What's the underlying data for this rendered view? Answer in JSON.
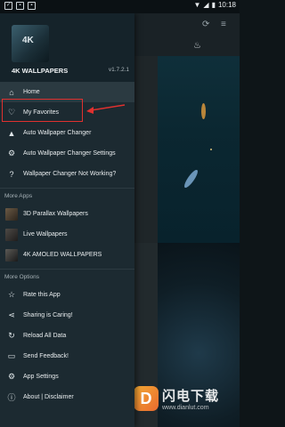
{
  "status_bar": {
    "time": "10:18"
  },
  "app": {
    "title": "4K WALLPAPERS",
    "version": "v1.7.2.1",
    "logo_text": "4K"
  },
  "menu": [
    {
      "label": "Home",
      "icon": "home-icon"
    },
    {
      "label": "My Favorites",
      "icon": "heart-icon"
    },
    {
      "label": "Auto Wallpaper Changer",
      "icon": "mountain-icon"
    },
    {
      "label": "Auto Wallpaper Changer Settings",
      "icon": "gear-icon"
    },
    {
      "label": "Wallpaper Changer Not Working?",
      "icon": "help-icon"
    }
  ],
  "more_apps": {
    "header": "More Apps",
    "items": [
      {
        "label": "3D Parallax Wallpapers"
      },
      {
        "label": "Live Wallpapers"
      },
      {
        "label": "4K AMOLED WALLPAPERS"
      }
    ]
  },
  "more_options": {
    "header": "More Options",
    "items": [
      {
        "label": "Rate this App",
        "icon": "star-icon"
      },
      {
        "label": "Sharing is Caring!",
        "icon": "share-icon"
      },
      {
        "label": "Reload All Data",
        "icon": "reload-icon"
      },
      {
        "label": "Send Feedback!",
        "icon": "feedback-icon"
      },
      {
        "label": "App Settings",
        "icon": "gear-icon"
      },
      {
        "label": "About | Disclaimer",
        "icon": "info-icon"
      }
    ]
  },
  "watermark": {
    "logo": "D",
    "title": "闪电下载",
    "url": "www.dianlut.com"
  },
  "colors": {
    "drawer": "#1c2a31",
    "active": "#2b3a41",
    "highlight": "#e0312f"
  }
}
